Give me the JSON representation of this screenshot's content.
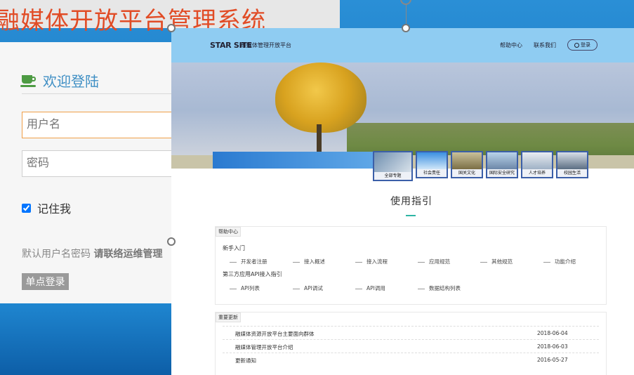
{
  "app_title": "融媒体开放平台管理系统",
  "login": {
    "welcome": "欢迎登陆",
    "username_placeholder": "用户名",
    "password_placeholder": "密码",
    "remember_label": "记住我",
    "hint_prefix": "默认用户名密码 ",
    "hint_strong": "请联络运维管理",
    "sso_button": "单点登录"
  },
  "site": {
    "logo": "STAR SITE",
    "logo_subtitle": "融媒体管理开放平台",
    "nav": {
      "help": "帮助中心",
      "contact": "联系我们",
      "login": "登录"
    },
    "categories": [
      "全部专题",
      "社会责任",
      "国关文化",
      "国际安全研究",
      "人才培养",
      "校园生活"
    ],
    "guide_title": "使用指引",
    "help_panel": {
      "tag": "帮助中心",
      "sections": [
        {
          "title": "新手入门",
          "items": [
            "开发者注册",
            "接入概述",
            "接入流程",
            "应用规范",
            "其他规范",
            "功能介绍"
          ]
        },
        {
          "title": "第三方应用API接入指引",
          "items": [
            "API列表",
            "API调试",
            "API调用",
            "数据结构列表"
          ]
        }
      ]
    },
    "news_panel": {
      "tag": "重要更新",
      "rows": [
        {
          "title": "融媒体资源开放平台主要面向群体",
          "date": "2018-06-04"
        },
        {
          "title": "融媒体管理开放平台介绍",
          "date": "2018-06-03"
        },
        {
          "title": "更新通知",
          "date": "2016-05-27"
        }
      ]
    }
  },
  "colors": {
    "title_red": "#e14c26",
    "header_blue": "#8fccf2",
    "welcome_blue": "#3f8fc4",
    "accent_teal": "#2fb5a4"
  }
}
